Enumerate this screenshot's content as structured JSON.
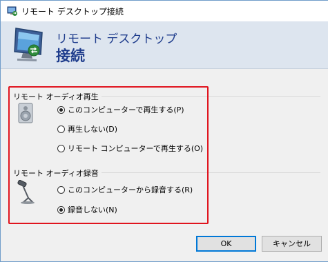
{
  "window": {
    "title": "リモート デスクトップ接続"
  },
  "banner": {
    "line1": "リモート デスクトップ",
    "line2": "接続"
  },
  "playback": {
    "label": "リモート オーディオ再生",
    "options": [
      {
        "label": "このコンピューターで再生する(P)",
        "selected": true
      },
      {
        "label": "再生しない(D)",
        "selected": false
      },
      {
        "label": "リモート コンピューターで再生する(O)",
        "selected": false
      }
    ]
  },
  "recording": {
    "label": "リモート オーディオ録音",
    "options": [
      {
        "label": "このコンピューターから録音する(R)",
        "selected": false
      },
      {
        "label": "録音しない(N)",
        "selected": true
      }
    ]
  },
  "buttons": {
    "ok": "OK",
    "cancel": "キャンセル"
  },
  "colors": {
    "highlight_box": "#e0141e",
    "banner_text": "#1e3c8c",
    "ok_border": "#0078d7"
  },
  "icons": [
    "remote-desktop-app-icon",
    "remote-desktop-monitor-icon",
    "speaker-icon",
    "microphone-icon"
  ]
}
